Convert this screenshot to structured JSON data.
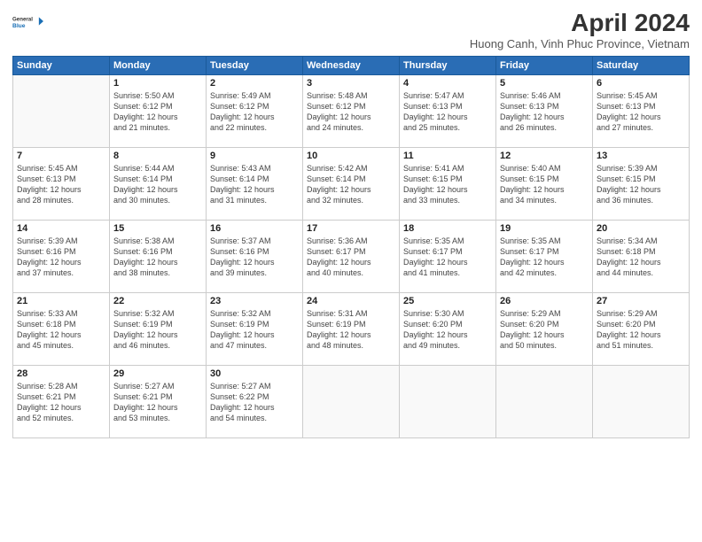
{
  "header": {
    "logo_line1": "General",
    "logo_line2": "Blue",
    "title": "April 2024",
    "subtitle": "Huong Canh, Vinh Phuc Province, Vietnam"
  },
  "days_of_week": [
    "Sunday",
    "Monday",
    "Tuesday",
    "Wednesday",
    "Thursday",
    "Friday",
    "Saturday"
  ],
  "weeks": [
    [
      {
        "day": "",
        "info": ""
      },
      {
        "day": "1",
        "info": "Sunrise: 5:50 AM\nSunset: 6:12 PM\nDaylight: 12 hours\nand 21 minutes."
      },
      {
        "day": "2",
        "info": "Sunrise: 5:49 AM\nSunset: 6:12 PM\nDaylight: 12 hours\nand 22 minutes."
      },
      {
        "day": "3",
        "info": "Sunrise: 5:48 AM\nSunset: 6:12 PM\nDaylight: 12 hours\nand 24 minutes."
      },
      {
        "day": "4",
        "info": "Sunrise: 5:47 AM\nSunset: 6:13 PM\nDaylight: 12 hours\nand 25 minutes."
      },
      {
        "day": "5",
        "info": "Sunrise: 5:46 AM\nSunset: 6:13 PM\nDaylight: 12 hours\nand 26 minutes."
      },
      {
        "day": "6",
        "info": "Sunrise: 5:45 AM\nSunset: 6:13 PM\nDaylight: 12 hours\nand 27 minutes."
      }
    ],
    [
      {
        "day": "7",
        "info": "Sunrise: 5:45 AM\nSunset: 6:13 PM\nDaylight: 12 hours\nand 28 minutes."
      },
      {
        "day": "8",
        "info": "Sunrise: 5:44 AM\nSunset: 6:14 PM\nDaylight: 12 hours\nand 30 minutes."
      },
      {
        "day": "9",
        "info": "Sunrise: 5:43 AM\nSunset: 6:14 PM\nDaylight: 12 hours\nand 31 minutes."
      },
      {
        "day": "10",
        "info": "Sunrise: 5:42 AM\nSunset: 6:14 PM\nDaylight: 12 hours\nand 32 minutes."
      },
      {
        "day": "11",
        "info": "Sunrise: 5:41 AM\nSunset: 6:15 PM\nDaylight: 12 hours\nand 33 minutes."
      },
      {
        "day": "12",
        "info": "Sunrise: 5:40 AM\nSunset: 6:15 PM\nDaylight: 12 hours\nand 34 minutes."
      },
      {
        "day": "13",
        "info": "Sunrise: 5:39 AM\nSunset: 6:15 PM\nDaylight: 12 hours\nand 36 minutes."
      }
    ],
    [
      {
        "day": "14",
        "info": "Sunrise: 5:39 AM\nSunset: 6:16 PM\nDaylight: 12 hours\nand 37 minutes."
      },
      {
        "day": "15",
        "info": "Sunrise: 5:38 AM\nSunset: 6:16 PM\nDaylight: 12 hours\nand 38 minutes."
      },
      {
        "day": "16",
        "info": "Sunrise: 5:37 AM\nSunset: 6:16 PM\nDaylight: 12 hours\nand 39 minutes."
      },
      {
        "day": "17",
        "info": "Sunrise: 5:36 AM\nSunset: 6:17 PM\nDaylight: 12 hours\nand 40 minutes."
      },
      {
        "day": "18",
        "info": "Sunrise: 5:35 AM\nSunset: 6:17 PM\nDaylight: 12 hours\nand 41 minutes."
      },
      {
        "day": "19",
        "info": "Sunrise: 5:35 AM\nSunset: 6:17 PM\nDaylight: 12 hours\nand 42 minutes."
      },
      {
        "day": "20",
        "info": "Sunrise: 5:34 AM\nSunset: 6:18 PM\nDaylight: 12 hours\nand 44 minutes."
      }
    ],
    [
      {
        "day": "21",
        "info": "Sunrise: 5:33 AM\nSunset: 6:18 PM\nDaylight: 12 hours\nand 45 minutes."
      },
      {
        "day": "22",
        "info": "Sunrise: 5:32 AM\nSunset: 6:19 PM\nDaylight: 12 hours\nand 46 minutes."
      },
      {
        "day": "23",
        "info": "Sunrise: 5:32 AM\nSunset: 6:19 PM\nDaylight: 12 hours\nand 47 minutes."
      },
      {
        "day": "24",
        "info": "Sunrise: 5:31 AM\nSunset: 6:19 PM\nDaylight: 12 hours\nand 48 minutes."
      },
      {
        "day": "25",
        "info": "Sunrise: 5:30 AM\nSunset: 6:20 PM\nDaylight: 12 hours\nand 49 minutes."
      },
      {
        "day": "26",
        "info": "Sunrise: 5:29 AM\nSunset: 6:20 PM\nDaylight: 12 hours\nand 50 minutes."
      },
      {
        "day": "27",
        "info": "Sunrise: 5:29 AM\nSunset: 6:20 PM\nDaylight: 12 hours\nand 51 minutes."
      }
    ],
    [
      {
        "day": "28",
        "info": "Sunrise: 5:28 AM\nSunset: 6:21 PM\nDaylight: 12 hours\nand 52 minutes."
      },
      {
        "day": "29",
        "info": "Sunrise: 5:27 AM\nSunset: 6:21 PM\nDaylight: 12 hours\nand 53 minutes."
      },
      {
        "day": "30",
        "info": "Sunrise: 5:27 AM\nSunset: 6:22 PM\nDaylight: 12 hours\nand 54 minutes."
      },
      {
        "day": "",
        "info": ""
      },
      {
        "day": "",
        "info": ""
      },
      {
        "day": "",
        "info": ""
      },
      {
        "day": "",
        "info": ""
      }
    ]
  ]
}
